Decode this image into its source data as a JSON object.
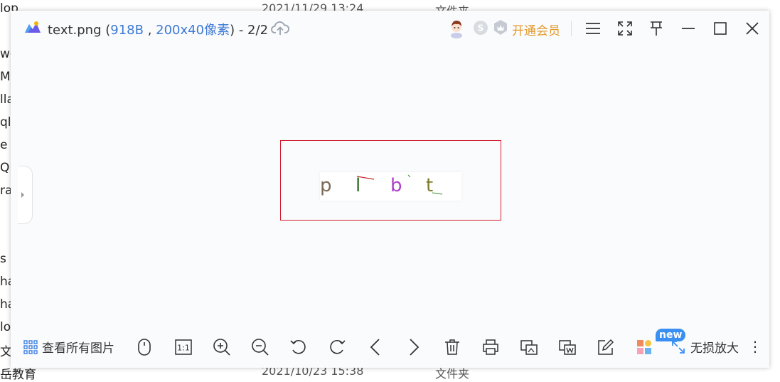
{
  "background": {
    "top_date": "2021/11/29 13:24",
    "top_type": "文件夹",
    "top_name": "lop",
    "bottom_date": "2021/10/23 15:38",
    "bottom_type": "文件夹",
    "bottom_name": "岳教育",
    "left_fragments": [
      "wo",
      "Ma",
      "lla",
      "ql",
      "e",
      "QL_",
      "ra",
      "s",
      "ha",
      "ha",
      "lov",
      "文!"
    ]
  },
  "titlebar": {
    "filename": "text.png",
    "open_paren": " (",
    "size": "918B",
    "comma": " , ",
    "dims": "200x40像素",
    "close_paren": ")",
    "position": " - 2/2",
    "vip_label": "开通会员"
  },
  "image": {
    "glyphs": [
      "p",
      "l",
      "b",
      "t"
    ],
    "colors": [
      "#7a6a55",
      "#2f6a1f",
      "#b03ec9",
      "#7c7a2a"
    ]
  },
  "toolbar": {
    "view_all_label": "查看所有图片",
    "one_to_one": "1:1",
    "new_badge": "new",
    "lossless_label": "无损放大",
    "more": "⋮"
  },
  "colors": {
    "accent_blue": "#3d7ad6",
    "vip_orange": "#e39a2b",
    "frame_red": "#d21f2d"
  }
}
